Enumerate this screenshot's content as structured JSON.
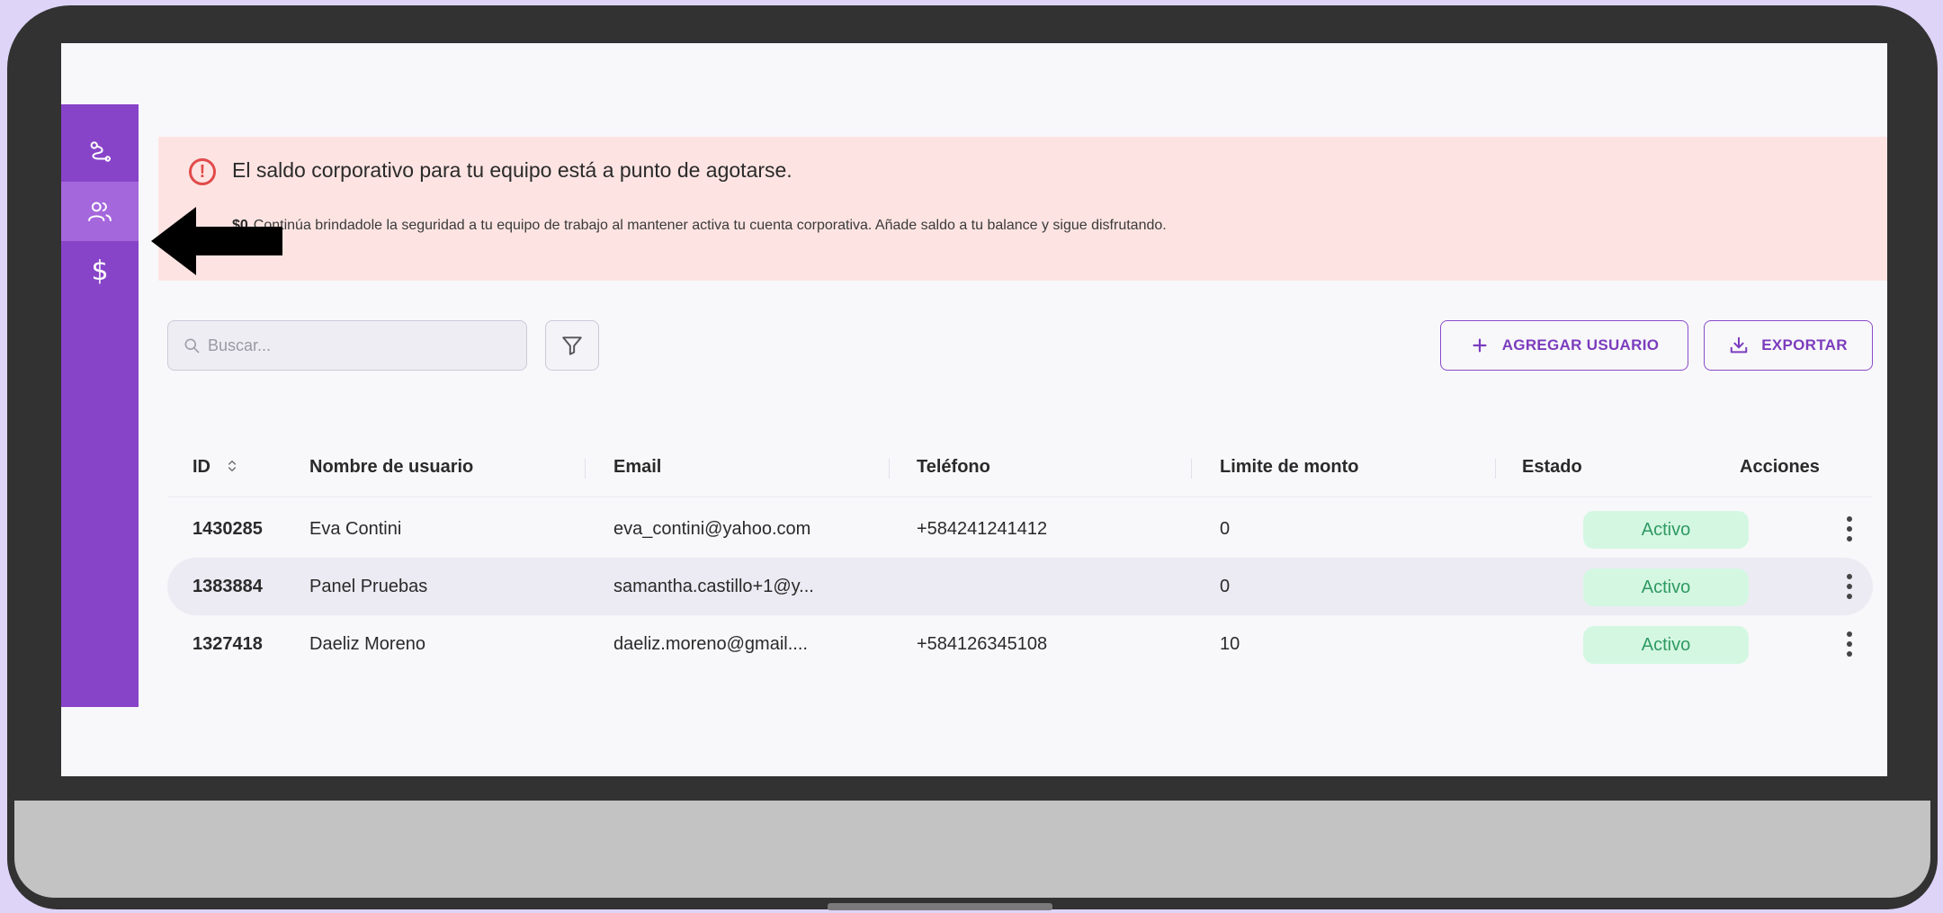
{
  "alert": {
    "title": "El saldo corporativo para tu equipo está a punto de agotarse.",
    "amount": "$0",
    "message": "Continúa brindadole la seguridad a tu equipo de trabajo al mantener activa tu cuenta corporativa. Añade saldo a tu balance y sigue disfrutando."
  },
  "sidebar": {
    "items": [
      {
        "icon": "route-icon"
      },
      {
        "icon": "users-icon",
        "active": true
      },
      {
        "icon": "dollar-icon",
        "glyph": "$"
      }
    ]
  },
  "toolbar": {
    "search_placeholder": "Buscar...",
    "add_label": "AGREGAR USUARIO",
    "export_label": "EXPORTAR"
  },
  "table": {
    "columns": [
      "ID",
      "Nombre de usuario",
      "Email",
      "Teléfono",
      "Limite de monto",
      "Estado",
      "Acciones"
    ],
    "rows": [
      {
        "id": "1430285",
        "name": "Eva Contini",
        "email": "eva_contini@yahoo.com",
        "phone": "+584241241412",
        "limit": "0",
        "status": "Activo"
      },
      {
        "id": "1383884",
        "name": "Panel Pruebas",
        "email": "samantha.castillo+1@y...",
        "phone": "",
        "limit": "0",
        "status": "Activo"
      },
      {
        "id": "1327418",
        "name": "Daeliz Moreno",
        "email": "daeliz.moreno@gmail....",
        "phone": "+584126345108",
        "limit": "10",
        "status": "Activo"
      }
    ]
  },
  "colors": {
    "accent": "#8844c8",
    "alert_bg": "#fde4e2",
    "status_bg": "#d4f7e2",
    "status_text": "#2f9a62"
  }
}
